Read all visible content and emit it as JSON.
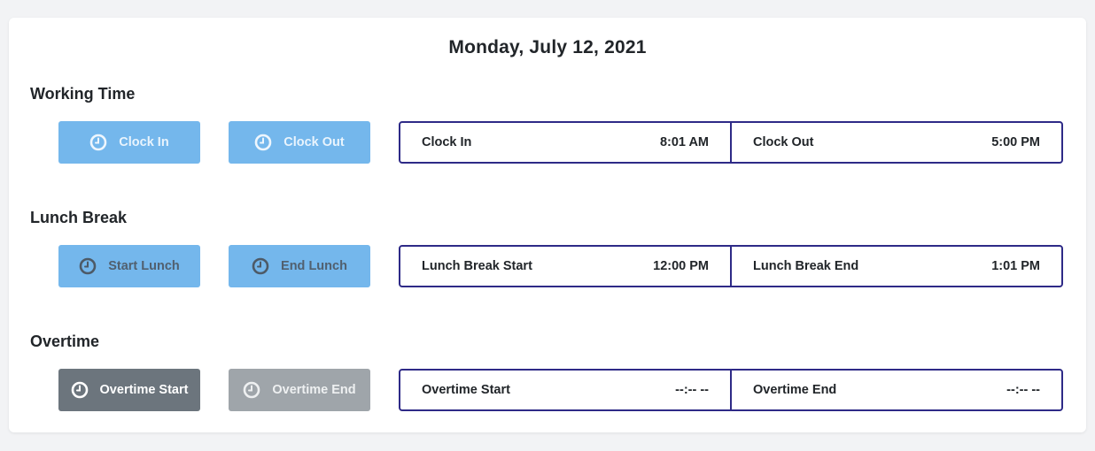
{
  "date": "Monday, July 12, 2021",
  "sections": [
    {
      "title": "Working Time",
      "buttons": [
        {
          "label": "Clock In",
          "icon": "clock-icon",
          "style": "blue-light"
        },
        {
          "label": "Clock Out",
          "icon": "clock-icon",
          "style": "blue-light"
        }
      ],
      "times": [
        {
          "label": "Clock In",
          "value": "8:01 AM"
        },
        {
          "label": "Clock Out",
          "value": "5:00 PM"
        }
      ]
    },
    {
      "title": "Lunch Break",
      "buttons": [
        {
          "label": "Start Lunch",
          "icon": "clock-icon",
          "style": "blue-dark"
        },
        {
          "label": "End Lunch",
          "icon": "clock-icon",
          "style": "blue-dark"
        }
      ],
      "times": [
        {
          "label": "Lunch Break Start",
          "value": "12:00 PM"
        },
        {
          "label": "Lunch Break End",
          "value": "1:01 PM"
        }
      ]
    },
    {
      "title": "Overtime",
      "buttons": [
        {
          "label": "Overtime Start",
          "icon": "clock-icon",
          "style": "grey-dark"
        },
        {
          "label": "Overtime End",
          "icon": "clock-icon",
          "style": "grey-light"
        }
      ],
      "times": [
        {
          "label": "Overtime Start",
          "value": "--:-- --"
        },
        {
          "label": "Overtime End",
          "value": "--:-- --"
        }
      ]
    }
  ],
  "colors": {
    "button_blue": "#74b7ec",
    "button_grey_dark": "#6c757d",
    "button_grey_light": "#9fa5aa",
    "box_border": "#2e2a87"
  }
}
